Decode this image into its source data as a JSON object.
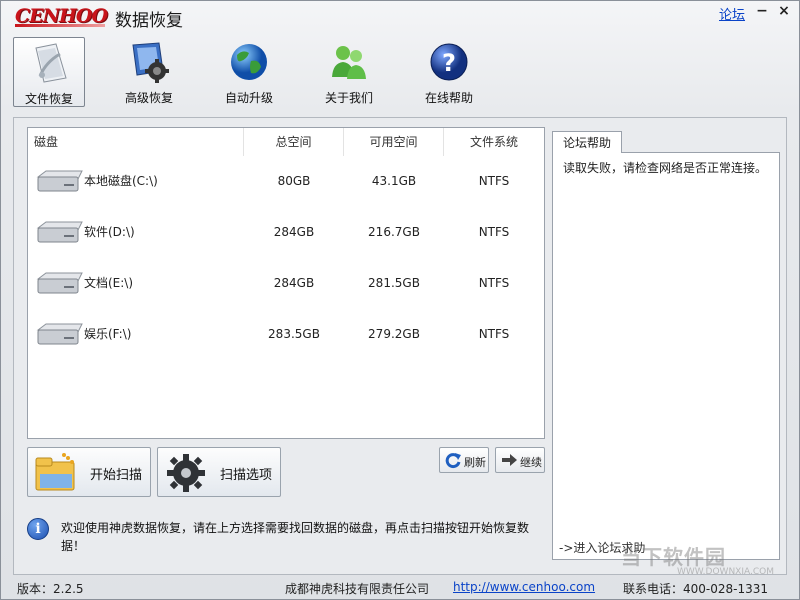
{
  "titlebar": {
    "logo": "CENHOO",
    "title": "数据恢复",
    "forum_link": "论坛",
    "minimize": "−",
    "close": "×"
  },
  "toolbar": {
    "items": [
      {
        "label": "文件恢复",
        "icon": "file-recovery-icon",
        "active": true
      },
      {
        "label": "高级恢复",
        "icon": "advanced-recovery-icon",
        "active": false
      },
      {
        "label": "自动升级",
        "icon": "globe-icon",
        "active": false
      },
      {
        "label": "关于我们",
        "icon": "users-icon",
        "active": false
      },
      {
        "label": "在线帮助",
        "icon": "help-icon",
        "active": false
      }
    ]
  },
  "disk_table": {
    "columns": [
      "磁盘",
      "总空间",
      "可用空间",
      "文件系统"
    ],
    "rows": [
      {
        "name": "本地磁盘(C:\\)",
        "total": "80GB",
        "free": "43.1GB",
        "fs": "NTFS"
      },
      {
        "name": "软件(D:\\)",
        "total": "284GB",
        "free": "216.7GB",
        "fs": "NTFS"
      },
      {
        "name": "文档(E:\\)",
        "total": "284GB",
        "free": "281.5GB",
        "fs": "NTFS"
      },
      {
        "name": "娱乐(F:\\)",
        "total": "283.5GB",
        "free": "279.2GB",
        "fs": "NTFS"
      }
    ]
  },
  "actions": {
    "start_scan": "开始扫描",
    "scan_options": "扫描选项",
    "refresh": "刷新",
    "continue": "继续"
  },
  "info": {
    "message": "欢迎使用神虎数据恢复，请在上方选择需要找回数据的磁盘，再点击扫描按钮开始恢复数据！"
  },
  "help": {
    "tab": "论坛帮助",
    "message": "读取失败，请检查网络是否正常连接。",
    "enter_forum": "->进入论坛求助"
  },
  "status": {
    "version": "版本：2.2.5",
    "company": "成都神虎科技有限责任公司",
    "url": "http://www.cenhoo.com",
    "phone": "联系电话：400-028-1331"
  },
  "watermark": {
    "text": "当下软件园",
    "sub": "WWW.DOWNXIA.COM"
  }
}
